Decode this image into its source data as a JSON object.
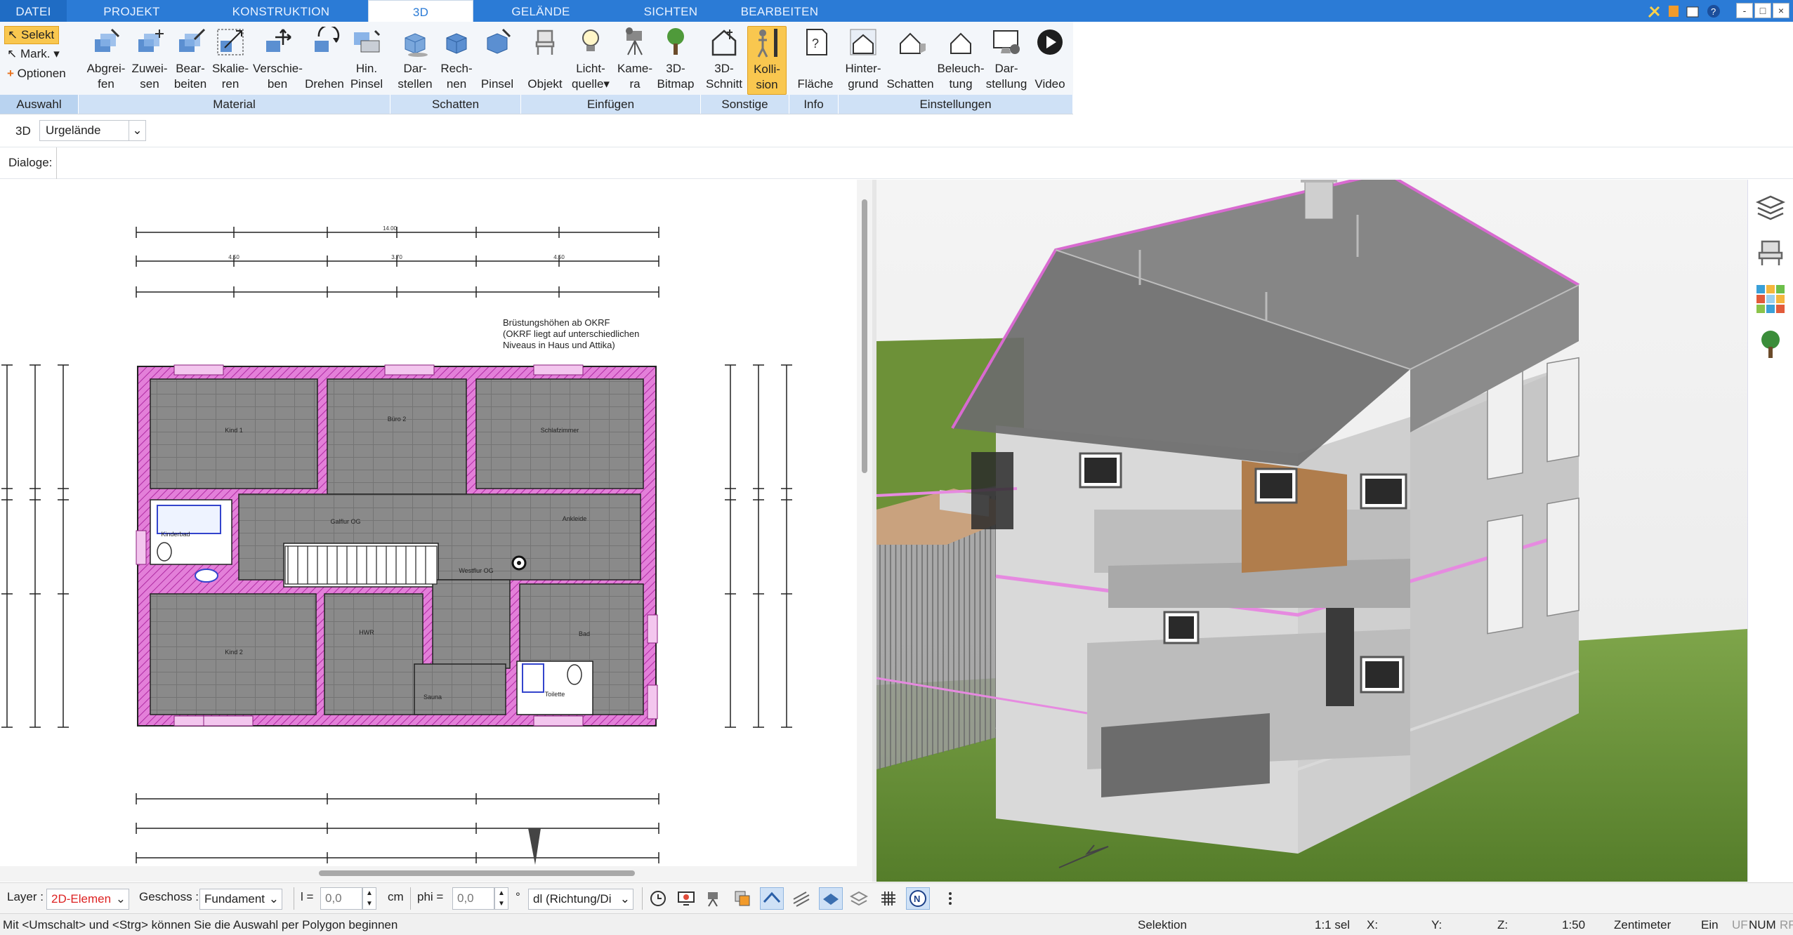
{
  "menu_tabs": [
    "DATEI",
    "PROJEKT",
    "KONSTRUKTION",
    "3D",
    "GELÄNDE",
    "SICHTEN",
    "BEARBEITEN"
  ],
  "active_tab": "3D",
  "window_controls": {
    "minimize": "-",
    "restore": "□",
    "close": "×"
  },
  "ribbon": {
    "auswahl": {
      "select": "Selekt",
      "mark": "Mark.",
      "options": "Optionen",
      "group": "Auswahl"
    },
    "material": {
      "items": [
        "Abgrei-\nfen",
        "Zuwei-\nsen",
        "Bear-\nbeiten",
        "Skalie-\nren",
        "Verschie-\nben",
        "Drehen",
        "Hin.\nPinsel"
      ],
      "group": "Material"
    },
    "schatten": {
      "items": [
        "Dar-\nstellen",
        "Rech-\nnen",
        "Pinsel"
      ],
      "group": "Schatten"
    },
    "einfuegen": {
      "items": [
        "Objekt",
        "Licht-\nquelle",
        "Kame-\nra",
        "3D-\nBitmap"
      ],
      "group": "Einfügen"
    },
    "sonstige": {
      "items": [
        "3D-\nSchnitt",
        "Kolli-\nsion"
      ],
      "group": "Sonstige"
    },
    "info": {
      "items": [
        "Fläche"
      ],
      "group": "Info"
    },
    "einstellungen": {
      "items": [
        "Hinter-\ngrund",
        "Schatten",
        "Beleuch-\ntung",
        "Dar-\nstellung",
        "Video"
      ],
      "group": "Einstellungen"
    }
  },
  "toolrow": {
    "mode": "3D",
    "terrain": "Urgelände"
  },
  "dialog_label": "Dialoge:",
  "plan": {
    "note": [
      "Brüstungshöhen ab OKRF",
      "(OKRF liegt auf unterschiedlichen",
      "Niveaus in Haus und Attika)"
    ],
    "rooms": [
      "Kind 1",
      "Büro 2",
      "Schlafzimmer",
      "Galflur OG",
      "Ankleide",
      "Kinderbad",
      "Westflur OG",
      "HWR",
      "Bad",
      "Kind 2",
      "Sauna",
      "Toilette"
    ],
    "dims_top": [
      "14.00",
      "4.50",
      "3.70",
      "4.50"
    ]
  },
  "bottombar": {
    "layer_label": "Layer :",
    "layer_value": "2D-Elemen",
    "geschoss_label": "Geschoss :",
    "geschoss_value": "Fundament",
    "l_label": "l =",
    "l_value": "0,0",
    "l_unit": "cm",
    "phi_label": "phi =",
    "phi_value": "0,0",
    "phi_unit": "°",
    "dl_value": "dl (Richtung/Di"
  },
  "statusbar": {
    "hint": "Mit <Umschalt> und <Strg> können Sie die Auswahl per Polygon beginnen",
    "mode": "Selektion",
    "sel": "1:1 sel",
    "x": "X:",
    "y": "Y:",
    "z": "Z:",
    "scale": "1:50",
    "unit": "Zentimeter",
    "ein": "Ein",
    "uf": "UF",
    "num": "NUM",
    "rf": "RF"
  },
  "colors": {
    "accent": "#2b7bd6",
    "wall": "#d451c6",
    "floor": "#8e8e8e",
    "grass": "#5e8a2e"
  }
}
